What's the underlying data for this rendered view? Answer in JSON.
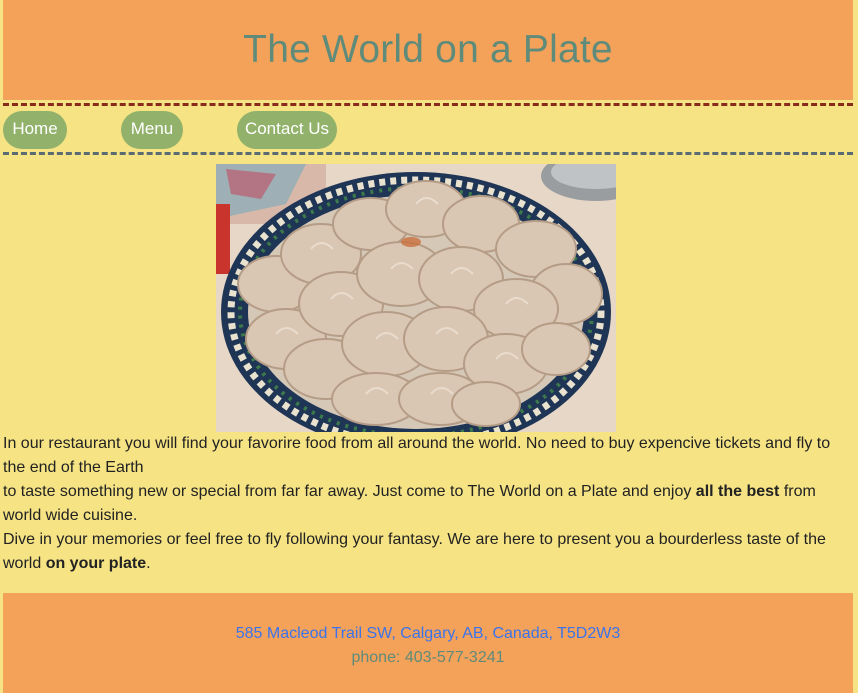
{
  "header": {
    "title": "The World on a Plate"
  },
  "nav": {
    "items": [
      {
        "label": "Home"
      },
      {
        "label": "Menu"
      },
      {
        "label": "Contact Us"
      }
    ]
  },
  "photo": {
    "subject": "plate-of-dumplings"
  },
  "content": {
    "line1": "In our restaurant you will find your favorire food from all around the world. No need to buy expencive tickets and fly to the end of the Earth",
    "line2_before": "to taste something new or special from far far away. Just come to The World on a Plate and enjoy ",
    "line2_bold": "all the best",
    "line2_after": " from world wide cuisine.",
    "line3_before": "Dive in your memories or feel free to fly following your fantasy. We are here to present you a bourderless taste of the world ",
    "line3_bold": "on your plate",
    "line3_after": "."
  },
  "footer": {
    "address": "585 Macleod Trail SW, Calgary, AB, Canada, T5D2W3",
    "phone": "phone: 403-577-3241"
  },
  "colors": {
    "page_bg": "#f5e384",
    "header_bg": "#f4a15a",
    "title_color": "#5f8b7a",
    "nav_button_bg": "#92b26b",
    "address_link": "#3a74ec"
  }
}
